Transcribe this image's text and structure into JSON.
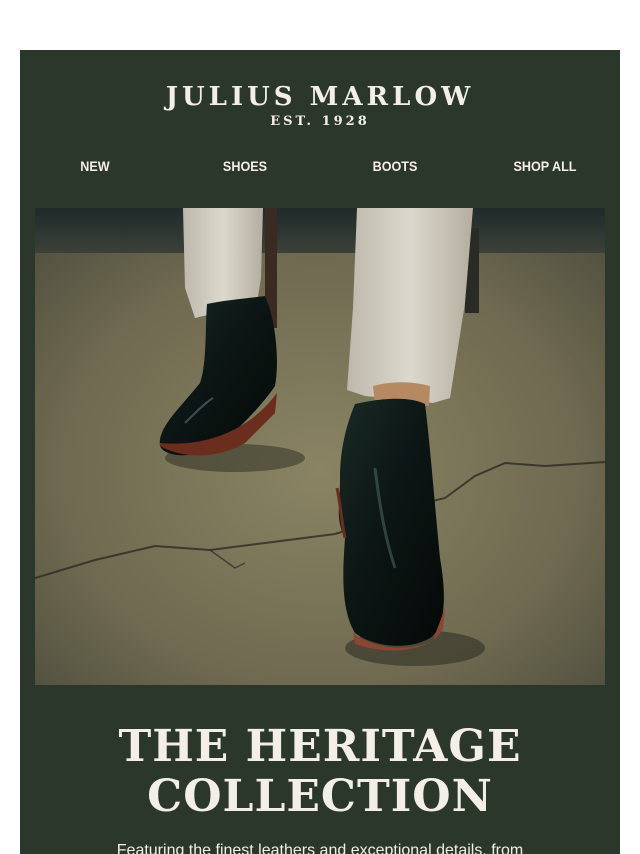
{
  "brand": {
    "name": "JULIUS MARLOW",
    "established": "EST. 1928"
  },
  "nav": {
    "items": [
      "NEW",
      "SHOES",
      "BOOTS",
      "SHOP ALL"
    ]
  },
  "hero": {
    "headline_line1": "THE HERITAGE",
    "headline_line2": "COLLECTION",
    "subtext": "Featuring the finest leathers and exceptional details, from"
  },
  "colors": {
    "background": "#2c372c",
    "text": "#f3efe6",
    "page": "#ffffff"
  }
}
